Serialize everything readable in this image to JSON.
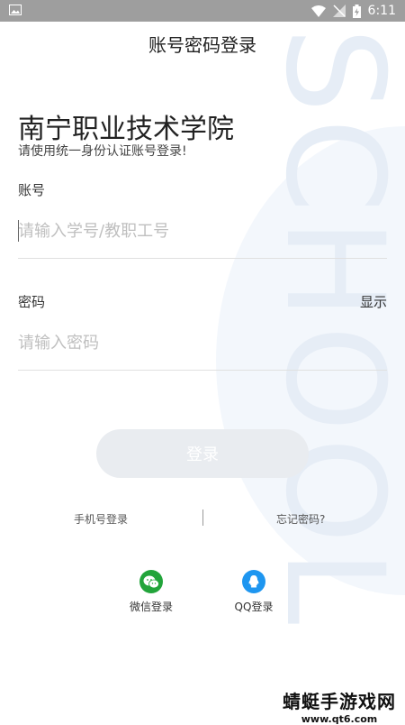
{
  "status_bar": {
    "time": "6:11"
  },
  "header": {
    "title": "账号密码登录"
  },
  "school": {
    "name": "南宁职业技术学院",
    "subtitle": "请使用统一身份认证账号登录!"
  },
  "watermark": {
    "text": "SCHOOL"
  },
  "form": {
    "account_label": "账号",
    "account_placeholder": "请输入学号/教职工号",
    "password_label": "密码",
    "password_placeholder": "请输入密码",
    "show_label": "显示"
  },
  "login_button": "登录",
  "links": {
    "phone_login": "手机号登录",
    "forgot_password": "忘记密码?"
  },
  "social": [
    {
      "label": "微信登录",
      "icon": "wechat-icon",
      "color": "#22a43a"
    },
    {
      "label": "QQ登录",
      "icon": "qq-icon",
      "color": "#1e96f0"
    }
  ],
  "brand": {
    "name": "蜻蜓手游戏网",
    "url": "www.qt6.com"
  }
}
